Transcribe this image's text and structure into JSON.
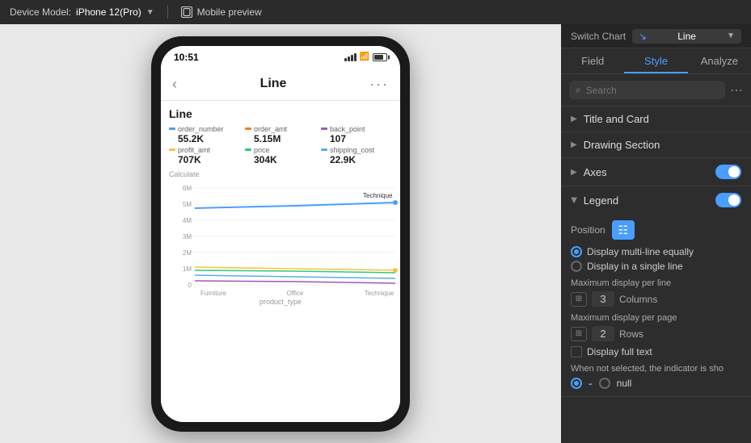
{
  "topbar": {
    "device_label": "Device Model:",
    "device_model": "iPhone 12(Pro)",
    "mobile_preview": "Mobile preview"
  },
  "switch_chart": {
    "label": "Switch Chart",
    "chart_type": "Line"
  },
  "tabs": [
    {
      "id": "field",
      "label": "Field"
    },
    {
      "id": "style",
      "label": "Style",
      "active": true
    },
    {
      "id": "analyze",
      "label": "Analyze"
    }
  ],
  "search": {
    "placeholder": "Search"
  },
  "sections": [
    {
      "id": "title-card",
      "label": "Title and Card",
      "expanded": false
    },
    {
      "id": "drawing-section",
      "label": "Drawing Section",
      "expanded": false
    },
    {
      "id": "axes",
      "label": "Axes",
      "expanded": false,
      "toggle": true,
      "toggle_on": true
    },
    {
      "id": "legend",
      "label": "Legend",
      "expanded": true,
      "toggle": true,
      "toggle_on": true
    }
  ],
  "legend_settings": {
    "position_label": "Position",
    "radio_options": [
      {
        "label": "Display multi-line equally",
        "checked": true
      },
      {
        "label": "Display in a single line",
        "checked": false
      }
    ],
    "max_per_line_label": "Maximum display per line",
    "max_per_line_value": "3",
    "max_per_line_unit": "Columns",
    "max_per_page_label": "Maximum display per page",
    "max_per_page_value": "2",
    "max_per_page_unit": "Rows",
    "display_full_text": "Display full text",
    "when_not_selected_label": "When not selected, the indicator is sho",
    "indicator_dash": "-",
    "indicator_null": "null"
  },
  "phone": {
    "time": "10:51",
    "chart_title": "Line",
    "data_title": "Line",
    "metrics": [
      {
        "name": "order_number",
        "color": "#4a9eff",
        "value": "55.2K"
      },
      {
        "name": "order_amt",
        "color": "#f0802a",
        "value": "5.15M"
      },
      {
        "name": "back_point",
        "color": "#9b59b6",
        "value": "107"
      },
      {
        "name": "profit_amt",
        "color": "#f4c542",
        "value": "707K"
      },
      {
        "name": "price",
        "color": "#2ecc71",
        "value": "304K"
      },
      {
        "name": "shipping_cost",
        "color": "#5dade2",
        "value": "22.9K"
      }
    ],
    "y_label": "Calculate",
    "x_label": "product_type",
    "x_ticks": [
      "Furniture",
      "Office",
      "Technique"
    ],
    "y_ticks": [
      "6M",
      "5M",
      "4M",
      "3M",
      "2M",
      "1M",
      "0"
    ],
    "technique_label": "Technique"
  }
}
